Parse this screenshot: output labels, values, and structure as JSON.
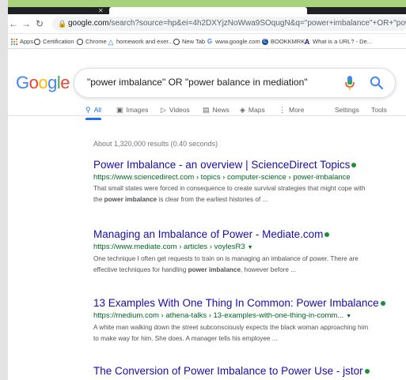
{
  "browser": {
    "url_host": "google.com",
    "url_path": "/search?source=hp&ei=4h2DXYjzNoWwa9SOqugN&q=\"power+imbalance\"+OR+\"power+balance+in+media"
  },
  "bookmarks": [
    {
      "label": "Apps",
      "icon": "apps-grid-icon",
      "color": "#ea4335"
    },
    {
      "label": "Certification",
      "icon": "globe-icon",
      "color": "#3c4043"
    },
    {
      "label": "Chrome",
      "icon": "globe-icon",
      "color": "#3c4043"
    },
    {
      "label": "homework and exer...",
      "icon": "drive-icon",
      "color": "#1a73e8"
    },
    {
      "label": "New Tab",
      "icon": "globe-icon",
      "color": "#3c4043"
    },
    {
      "label": "www.google.com",
      "icon": "google-g-icon",
      "color": "#4285f4"
    },
    {
      "label": "BOOKKMRK",
      "icon": "bookmark-c-icon",
      "color": "#174ea6"
    },
    {
      "label": "What is a URL? - De...",
      "icon": "a-logo-icon",
      "color": "#1a237e"
    }
  ],
  "logo": {
    "l1": "G",
    "l2": "o",
    "l3": "o",
    "l4": "g",
    "l5": "l",
    "l6": "e"
  },
  "search": {
    "query": "\"power imbalance\" OR \"power balance in mediation\""
  },
  "tabs": [
    {
      "label": "All",
      "icon": "search-icon",
      "active": true
    },
    {
      "label": "Images",
      "icon": "image-icon"
    },
    {
      "label": "Videos",
      "icon": "video-icon"
    },
    {
      "label": "News",
      "icon": "news-icon"
    },
    {
      "label": "Maps",
      "icon": "map-icon"
    },
    {
      "label": "More",
      "icon": "more-dots-icon"
    },
    {
      "label": "Settings"
    },
    {
      "label": "Tools"
    }
  ],
  "stats": "About 1,320,000 results (0.40 seconds)",
  "results": [
    {
      "title": "Power Imbalance - an overview | ScienceDirect Topics",
      "url": "https://www.sciencedirect.com › topics › computer-science › power-imbalance",
      "snippet1": "That small states were forced in consequence to create survival strategies that might cope with",
      "snippet2_pre": "the ",
      "snippet2_bold": "power imbalance",
      "snippet2_post": " is clear from the earliest histories of ..."
    },
    {
      "title": "Managing an Imbalance of Power - Mediate.com",
      "url": "https://www.mediate.com › articles › voylesR3",
      "snippet1": "One technique I often get requests to train on is managing an imbalance of power. There are",
      "snippet2_pre": "effective techniques for handling ",
      "snippet2_bold": "power imbalance",
      "snippet2_post": ", however before ..."
    },
    {
      "title": "13 Examples With One Thing In Common: Power Imbalance",
      "url": "https://medium.com › athena-talks › 13-examples-with-one-thing-in-comm...",
      "snippet1": "A white man walking down the street subconsciously expects the black woman approaching him",
      "snippet2_pre": "to make way for him. She does. A manager tells his employee ...",
      "snippet2_bold": "",
      "snippet2_post": ""
    },
    {
      "title": "The Conversion of Power Imbalance to Power Use - jstor"
    }
  ]
}
